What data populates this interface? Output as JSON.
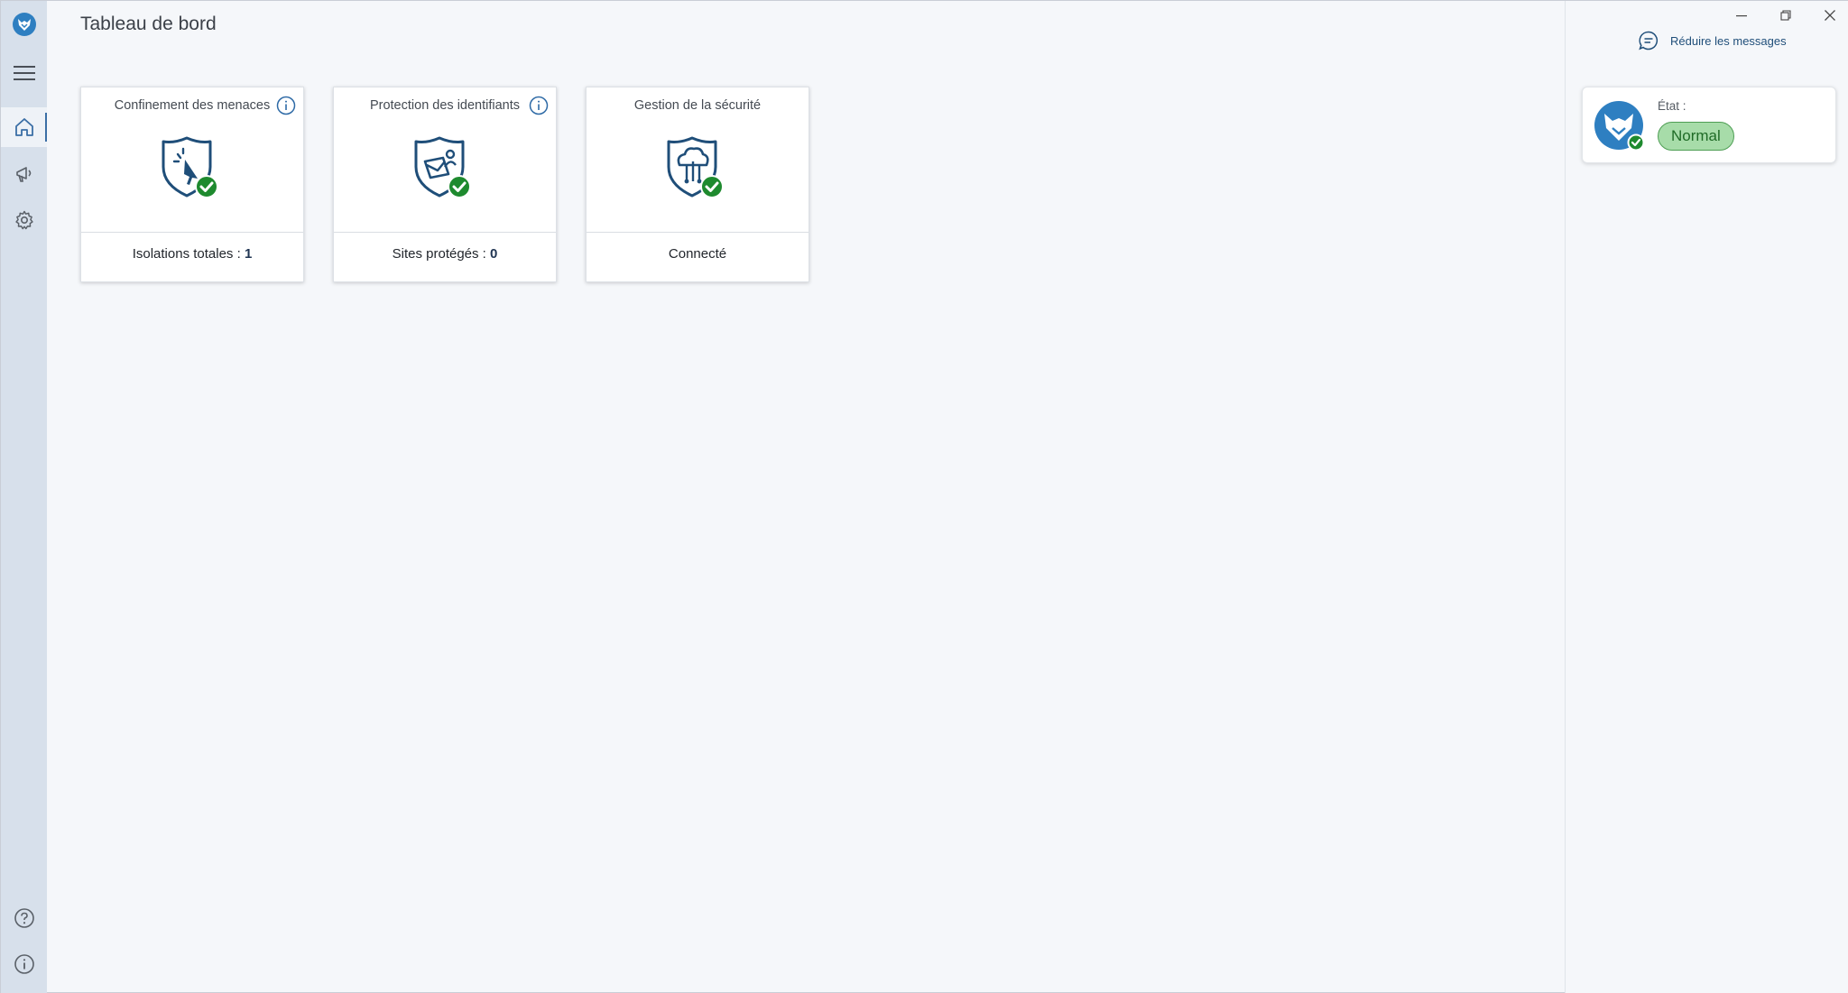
{
  "header": {
    "title": "Tableau de bord"
  },
  "colors": {
    "rail": "#d7e0eb",
    "accent": "#1f4e79",
    "success": "#1e8a2e",
    "status_bg": "#a7dca9"
  },
  "rail": {
    "items": [
      {
        "name": "logo",
        "icon": "app-logo-icon"
      },
      {
        "name": "menu",
        "icon": "hamburger-icon"
      },
      {
        "name": "home",
        "icon": "home-icon",
        "active": true
      },
      {
        "name": "alerts",
        "icon": "megaphone-icon"
      },
      {
        "name": "settings",
        "icon": "gear-icon"
      },
      {
        "name": "help",
        "icon": "help-icon"
      },
      {
        "name": "about",
        "icon": "info-icon"
      }
    ]
  },
  "cards": [
    {
      "title": "Confinement des menaces",
      "footer_label": "Isolations totales : ",
      "footer_value": "1",
      "icon": "shield-cursor-icon",
      "has_info": true
    },
    {
      "title": "Protection des identifiants",
      "footer_label": "Sites protégés : ",
      "footer_value": "0",
      "icon": "shield-credentials-icon",
      "has_info": true
    },
    {
      "title": "Gestion de la sécurité",
      "footer_label": "Connecté",
      "footer_value": "",
      "icon": "shield-cloud-icon",
      "has_info": false
    }
  ],
  "right_panel": {
    "reduce_label": "Réduire les messages",
    "status_label": "État :",
    "status_value": "Normal"
  },
  "window_controls": [
    "minimize-icon",
    "restore-icon",
    "close-icon"
  ]
}
